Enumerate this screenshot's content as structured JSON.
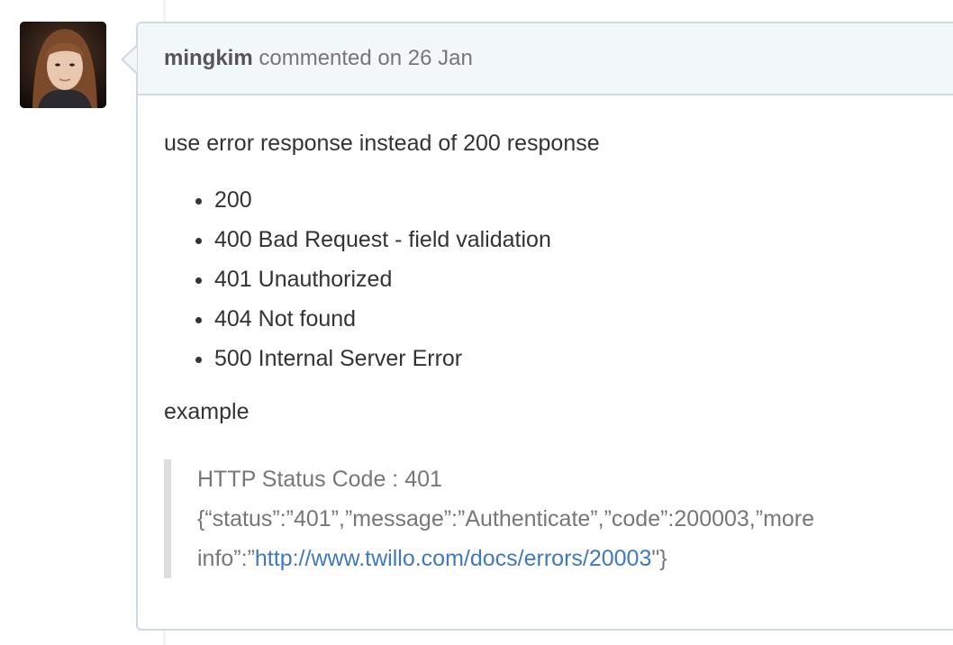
{
  "comment": {
    "author": "mingkim",
    "action_text": "commented on",
    "date": "26 Jan",
    "intro": "use error response instead of 200 response",
    "list_items": [
      "200",
      "400 Bad Request - field validation",
      "401 Unauthorized",
      "404 Not found",
      "500 Internal Server Error"
    ],
    "example_label": "example",
    "quote": {
      "line1": "HTTP Status Code : 401",
      "line2": "{“status”:”401”,”message”:”Authenticate”,”code”:200003,”more",
      "line3_prefix": "info”:”",
      "link_text": "http://www.twillo.com/docs/errors/20003",
      "line3_suffix": "\"}"
    }
  },
  "colors": {
    "header_bg": "#f2f8fa",
    "border": "#d1d9e0",
    "link": "#4078c0"
  }
}
